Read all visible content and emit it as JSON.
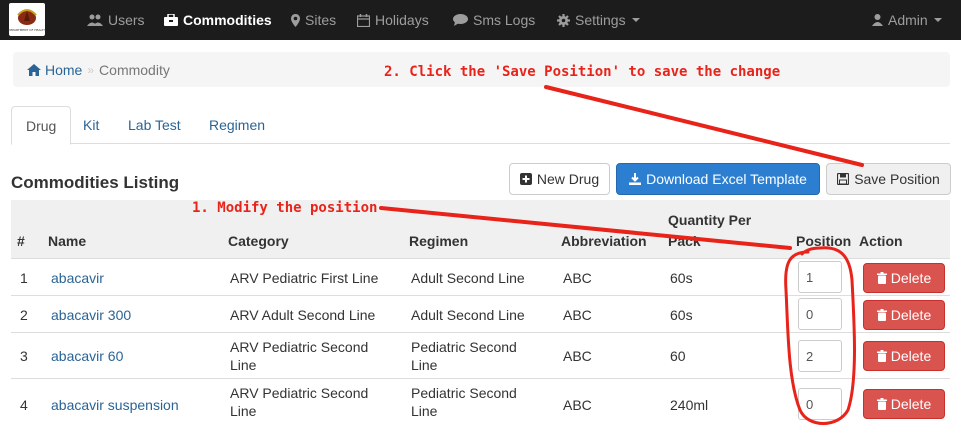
{
  "navbar": {
    "logo_text": "DEPARTMENT OF HEALTH",
    "items": [
      {
        "label": "Users",
        "icon": "users-icon"
      },
      {
        "label": "Commodities",
        "icon": "briefcase-icon",
        "active": true
      },
      {
        "label": "Sites",
        "icon": "map-marker-icon"
      },
      {
        "label": "Holidays",
        "icon": "calendar-icon"
      },
      {
        "label": "Sms Logs",
        "icon": "comment-icon"
      },
      {
        "label": "Settings",
        "icon": "gear-icon"
      }
    ],
    "user_label": "Admin"
  },
  "breadcrumb": {
    "home": "Home",
    "separator": "»",
    "current": "Commodity"
  },
  "annotations": {
    "step1": "1. Modify the position",
    "step2": "2. Click the 'Save Position' to save the change",
    "color": "#e8231a"
  },
  "tabs": [
    {
      "label": "Drug",
      "active": true
    },
    {
      "label": "Kit"
    },
    {
      "label": "Lab Test"
    },
    {
      "label": "Regimen"
    }
  ],
  "listing": {
    "title": "Commodities Listing",
    "new_drug": "New Drug",
    "download_template": "Download Excel Template",
    "save_position": "Save Position"
  },
  "table": {
    "headers": {
      "index": "#",
      "name": "Name",
      "category": "Category",
      "regimen": "Regimen",
      "abbreviation": "Abbreviation",
      "quantity_line1": "Quantity Per",
      "quantity_line2": "Pack",
      "position": "Position",
      "action": "Action"
    },
    "delete_label": "Delete",
    "rows": [
      {
        "index": "1",
        "name": "abacavir",
        "category_1": "ARV Pediatric First Line",
        "category_2": "",
        "regimen_1": "Adult Second Line",
        "regimen_2": "",
        "abbreviation": "ABC",
        "quantity": "60s",
        "position": "1"
      },
      {
        "index": "2",
        "name": "abacavir 300",
        "category_1": "ARV Adult Second Line",
        "category_2": "",
        "regimen_1": "Adult Second Line",
        "regimen_2": "",
        "abbreviation": "ABC",
        "quantity": "60s",
        "position": "0"
      },
      {
        "index": "3",
        "name": "abacavir 60",
        "category_1": "ARV Pediatric Second",
        "category_2": "Line",
        "regimen_1": "Pediatric Second",
        "regimen_2": "Line",
        "abbreviation": "ABC",
        "quantity": "60",
        "position": "2"
      },
      {
        "index": "4",
        "name": "abacavir suspension",
        "category_1": "ARV Pediatric Second",
        "category_2": "Line",
        "regimen_1": "Pediatric Second",
        "regimen_2": "Line",
        "abbreviation": "ABC",
        "quantity": "240ml",
        "position": "0"
      }
    ]
  }
}
